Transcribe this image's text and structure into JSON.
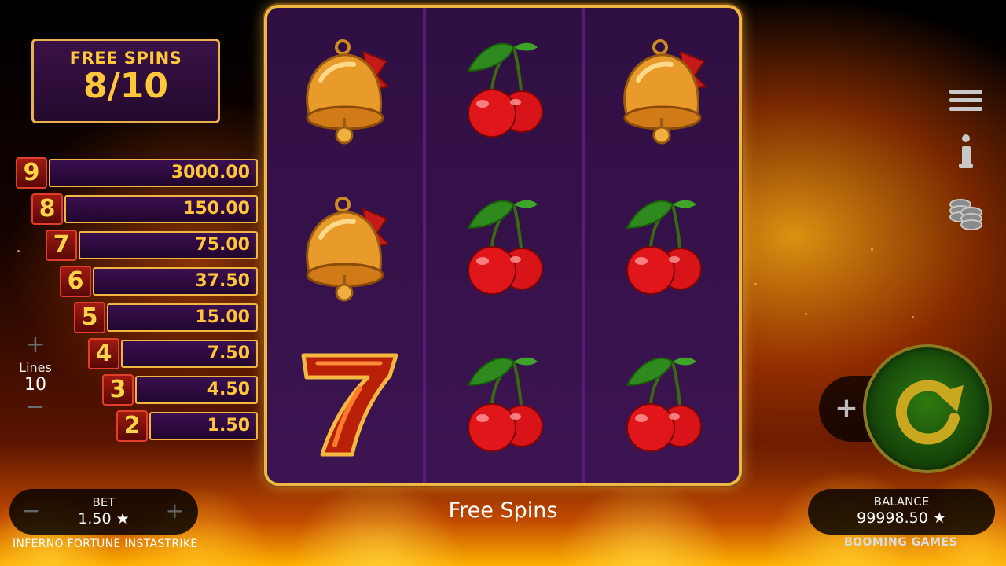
{
  "free_spins": {
    "label": "FREE SPINS",
    "count": "8/10"
  },
  "paytable": [
    {
      "num": "9",
      "amount": "3000.00"
    },
    {
      "num": "8",
      "amount": "150.00"
    },
    {
      "num": "7",
      "amount": "75.00"
    },
    {
      "num": "6",
      "amount": "37.50"
    },
    {
      "num": "5",
      "amount": "15.00"
    },
    {
      "num": "4",
      "amount": "7.50"
    },
    {
      "num": "3",
      "amount": "4.50"
    },
    {
      "num": "2",
      "amount": "1.50"
    }
  ],
  "lines": {
    "label": "Lines",
    "value": "10",
    "plus": "+",
    "minus": "−"
  },
  "reels": [
    [
      "bell-icon",
      "bell-icon",
      "seven-icon"
    ],
    [
      "cherry-icon",
      "cherry-icon",
      "cherry-icon"
    ],
    [
      "bell-icon",
      "cherry-icon",
      "cherry-icon"
    ]
  ],
  "bet": {
    "label": "BET",
    "value": "1.50 ★",
    "minus": "−",
    "plus": "+"
  },
  "game_title": "INFERNO FORTUNE INSTASTRIKE",
  "status": "Free Spins",
  "balance": {
    "label": "BALANCE",
    "value": "99998.50 ★"
  },
  "brand": "BOOMING GAMES",
  "spin_plus": "+",
  "colors": {
    "gold": "#f0b840",
    "reel_bg": "#2c0e3c",
    "spin_green": "#16480a",
    "payout_text": "#ffc53a"
  }
}
